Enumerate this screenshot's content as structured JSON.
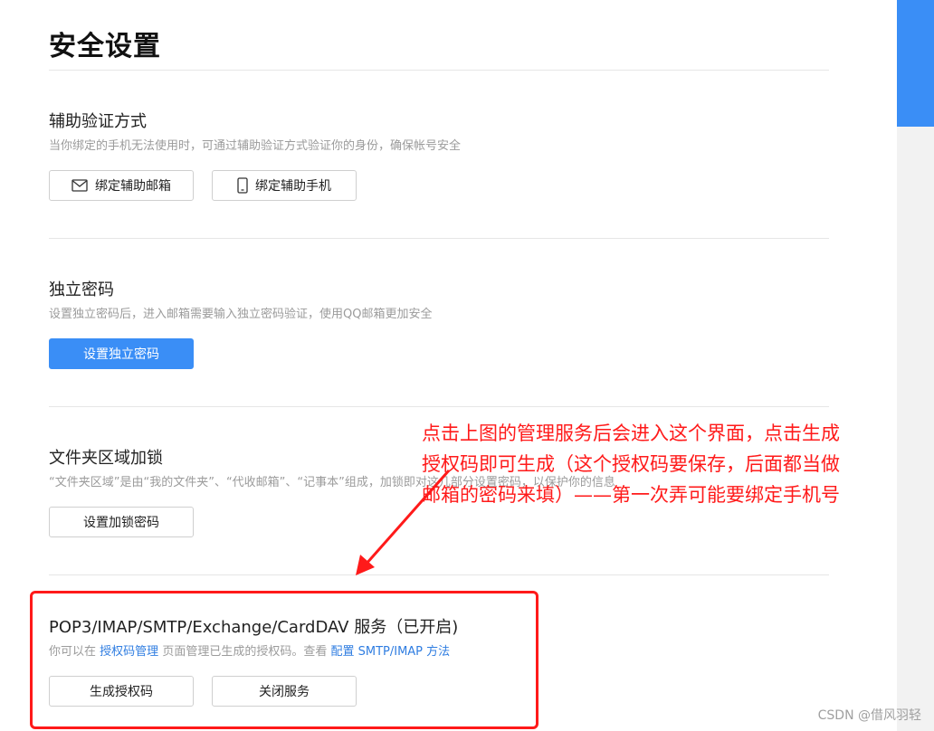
{
  "page": {
    "title": "安全设置"
  },
  "sections": {
    "aux": {
      "title": "辅助验证方式",
      "desc": "当你绑定的手机无法使用时，可通过辅助验证方式验证你的身份，确保帐号安全",
      "btn_email": "绑定辅助邮箱",
      "btn_phone": "绑定辅助手机"
    },
    "pwd": {
      "title": "独立密码",
      "desc": "设置独立密码后，进入邮箱需要输入独立密码验证，使用QQ邮箱更加安全",
      "btn": "设置独立密码"
    },
    "folder": {
      "title": "文件夹区域加锁",
      "desc": "“文件夹区域”是由“我的文件夹”、“代收邮箱”、“记事本”组成，加锁即对这几部分设置密码，以保护你的信息",
      "btn": "设置加锁密码"
    },
    "pop3": {
      "title": "POP3/IMAP/SMTP/Exchange/CardDAV 服务（已开启)",
      "desc_prefix": "你可以在",
      "link_auth": "授权码管理",
      "desc_mid": "页面管理已生成的授权码。查看",
      "link_config": "配置 SMTP/IMAP 方法",
      "btn_generate": "生成授权码",
      "btn_close": "关闭服务"
    }
  },
  "annotation": {
    "lines": [
      "点击上图的管理服务后会进入这个界面，点击生成",
      "授权码即可生成（这个授权码要保存，后面都当做",
      "邮箱的密码来填）——第一次弄可能要绑定手机号"
    ],
    "color": "#ff1a1a"
  },
  "watermark": "CSDN @借风羽轻",
  "colors": {
    "accent": "#3a8ef6",
    "link": "#2f7de1",
    "highlight": "#ff1a1a"
  }
}
